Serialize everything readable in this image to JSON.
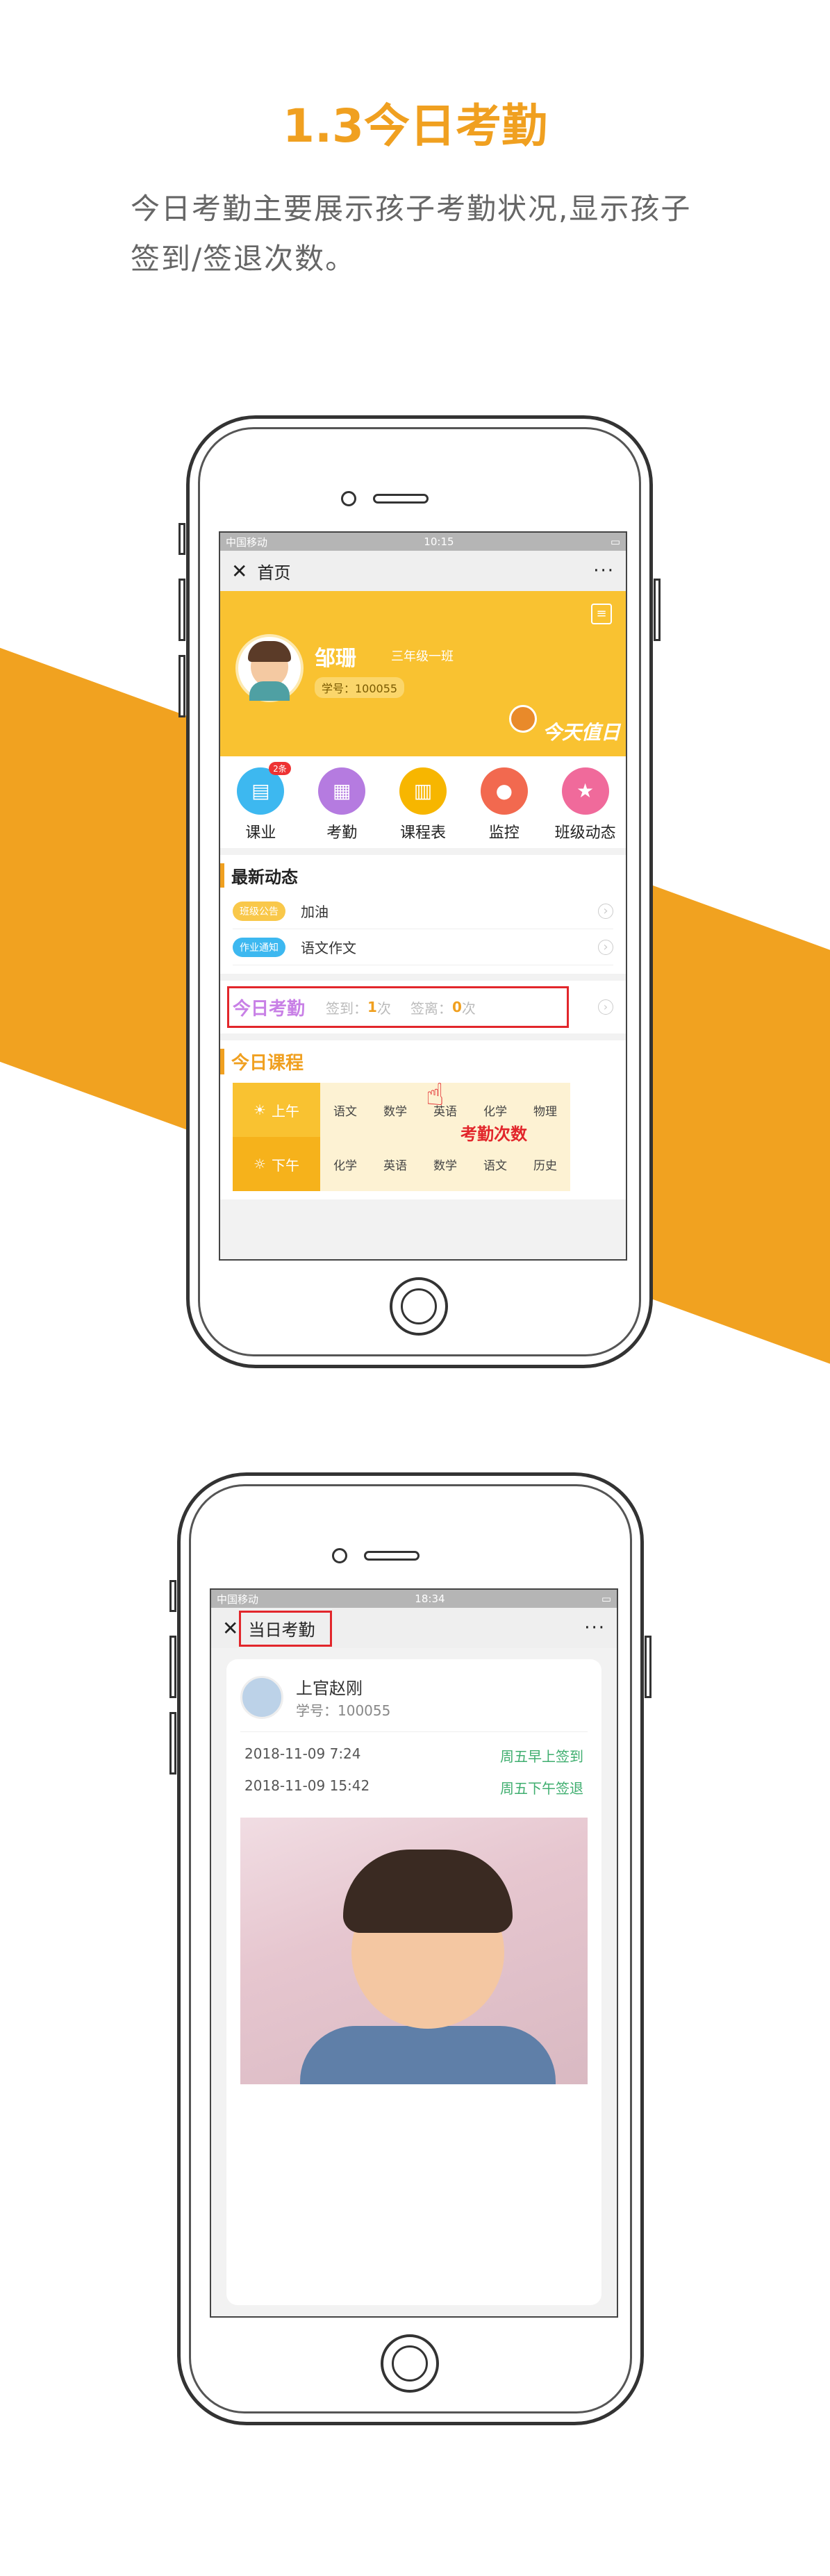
{
  "heading": {
    "title": "1.3今日考勤",
    "desc_line1": "今日考勤主要展示孩子考勤状况,显示孩子",
    "desc_line2": "签到/签退次数。"
  },
  "colors": {
    "accent": "#f1a220",
    "highlight": "#e2262b"
  },
  "screen1": {
    "status": {
      "left": "中国移动",
      "time": "10:15"
    },
    "nav": {
      "close_icon": "close-icon",
      "title": "首页",
      "more": "···"
    },
    "profile": {
      "name": "邹珊",
      "class": "三年级一班",
      "student_id": "学号：100055",
      "duty": "今天值日"
    },
    "icons": [
      {
        "label": "课业",
        "badge": "2条",
        "color": "#3db8f0",
        "glyph": "▤"
      },
      {
        "label": "考勤",
        "badge": "",
        "color": "#b57be0",
        "glyph": "▦"
      },
      {
        "label": "课程表",
        "badge": "",
        "color": "#f7b600",
        "glyph": "▥"
      },
      {
        "label": "监控",
        "badge": "",
        "color": "#f2694f",
        "glyph": "●"
      },
      {
        "label": "班级动态",
        "badge": "",
        "color": "#f06a9b",
        "glyph": "★"
      }
    ],
    "news": {
      "title": "最新动态",
      "items": [
        {
          "tag": "班级公告",
          "tag_color": "#f9c84a",
          "text": "加油"
        },
        {
          "tag": "作业通知",
          "tag_color": "#3db8f0",
          "text": "语文作文"
        }
      ]
    },
    "attendance": {
      "title": "今日考勤",
      "sign_in_label": "签到：",
      "sign_in_count": "1",
      "sign_out_label": "签离：",
      "sign_out_count": "0",
      "unit": "次",
      "note": "考勤次数"
    },
    "course": {
      "title": "今日课程",
      "morning": {
        "label": "上午",
        "subjects": [
          "语文",
          "数学",
          "英语",
          "化学",
          "物理"
        ]
      },
      "afternoon": {
        "label": "下午",
        "subjects": [
          "化学",
          "英语",
          "数学",
          "语文",
          "历史"
        ]
      }
    }
  },
  "screen2": {
    "status": {
      "left": "中国移动",
      "time": "18:34"
    },
    "nav": {
      "close_icon": "close-icon",
      "title": "当日考勤",
      "more": "···"
    },
    "student": {
      "name": "上官赵刚",
      "student_id": "学号：100055"
    },
    "records": [
      {
        "time": "2018-11-09   7:24",
        "status": "周五早上签到"
      },
      {
        "time": "2018-11-09 15:42",
        "status": "周五下午签退"
      }
    ]
  }
}
